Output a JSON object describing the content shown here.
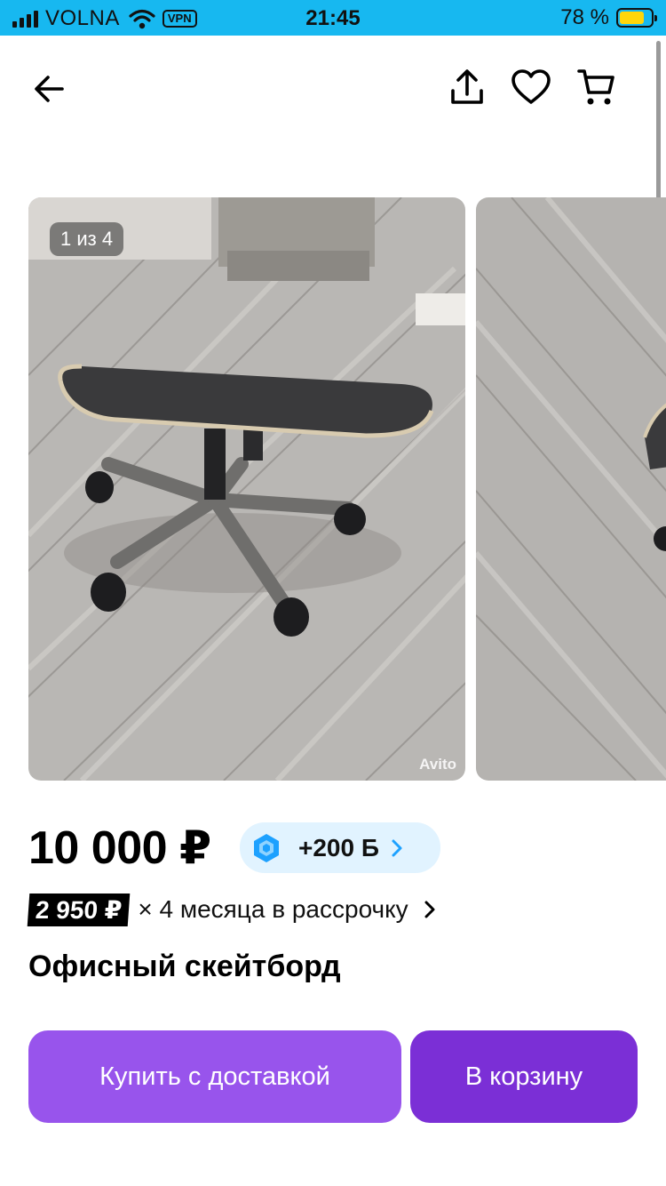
{
  "status_bar": {
    "carrier": "VOLNA",
    "vpn_label": "VPN",
    "time": "21:45",
    "battery_percent": "78 %",
    "battery_level": 0.78,
    "signal_icon": "signal-bars-icon",
    "wifi_icon": "wifi-icon"
  },
  "header": {
    "back_icon": "arrow-left-icon",
    "share_icon": "share-icon",
    "favorite_icon": "heart-icon",
    "cart_icon": "cart-icon"
  },
  "gallery": {
    "counter": "1 из 4",
    "watermark": "Avito"
  },
  "price": {
    "value": "10 000 ₽",
    "bonus": "+200 Б",
    "bonus_icon": "hexagon-bonus-icon",
    "bonus_color": "#1da1ff"
  },
  "installment": {
    "amount": "2 950 ₽",
    "text": "× 4 месяца в рассрочку"
  },
  "item": {
    "title": "Офисный скейтборд"
  },
  "actions": {
    "buy_label": "Купить с доставкой",
    "cart_label": "В корзину",
    "buy_color": "#9854ec",
    "cart_color": "#7b2fd6"
  }
}
